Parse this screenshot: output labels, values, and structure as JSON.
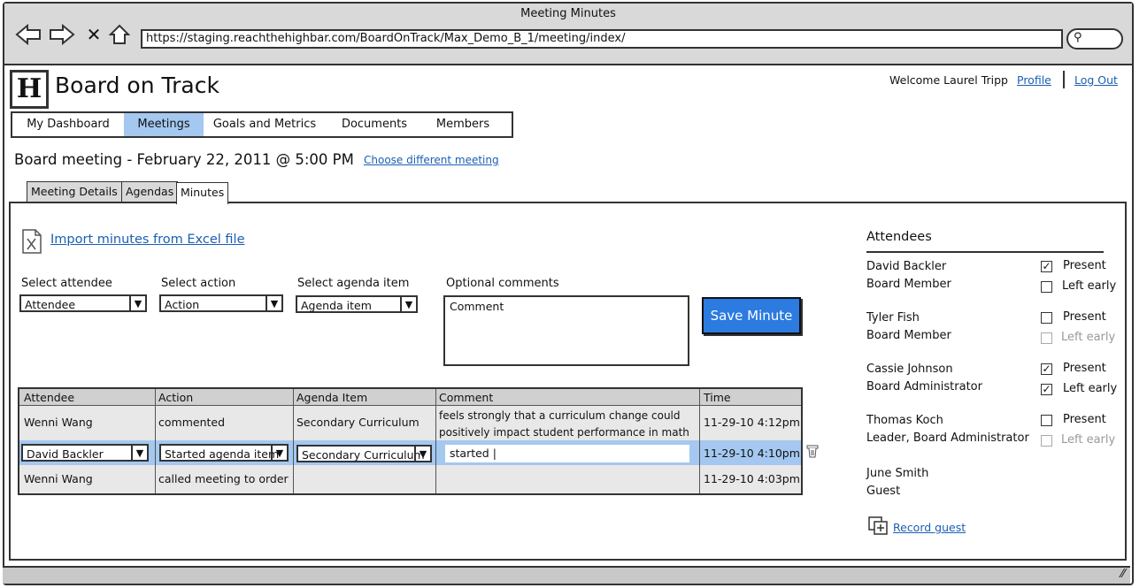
{
  "window": {
    "title": "Meeting Minutes",
    "url": "https://staging.reachthehighbar.com/BoardOnTrack/Max_Demo_B_1/meeting/index/"
  },
  "app": {
    "logo_letter": "H",
    "name": "Board on Track"
  },
  "user": {
    "welcome": "Welcome Laurel Tripp",
    "profile": "Profile",
    "logout": "Log Out"
  },
  "nav": {
    "items": [
      "My Dashboard",
      "Meetings",
      "Goals and Metrics",
      "Documents",
      "Members"
    ],
    "active": "Meetings",
    "accent": "#a4c8f0"
  },
  "meeting": {
    "title": "Board meeting - February 22, 2011 @ 5:00 PM",
    "change_link": "Choose different meeting"
  },
  "tabs": [
    "Meeting Details",
    "Agendas",
    "Minutes"
  ],
  "import": {
    "label": "Import minutes from Excel file",
    "icon": "excel-file-icon"
  },
  "form": {
    "attendee_label": "Select attendee",
    "attendee_value": "Attendee",
    "action_label": "Select action",
    "action_value": "Action",
    "agenda_label": "Select agenda item",
    "agenda_value": "Agenda item",
    "comments_label": "Optional comments",
    "comments_placeholder": "Comment",
    "save": "Save Minute",
    "save_color": "#2b7be0"
  },
  "table": {
    "headers": [
      "Attendee",
      "Action",
      "Agenda Item",
      "Comment",
      "Time"
    ],
    "rows": [
      {
        "attendee": "Wenni Wang",
        "action": "commented",
        "agenda": "Secondary Curriculum",
        "comment": "feels strongly that a curriculum change could positively impact student performance in math",
        "time": "11-29-10 4:12pm"
      },
      {
        "attendee": "David Backler",
        "action": "Started agenda item",
        "agenda": "Secondary Curriculum",
        "comment": "started |",
        "time": "11-29-10 4:10pm"
      },
      {
        "attendee": "Wenni Wang",
        "action": "called meeting to order",
        "agenda": "",
        "comment": "",
        "time": "11-29-10 4:03pm"
      }
    ]
  },
  "attendees": {
    "heading": "Attendees",
    "list": [
      {
        "name": "David Backler",
        "role": "Board Member",
        "present": true,
        "left_early": false,
        "left_early_enabled": true
      },
      {
        "name": "Tyler Fish",
        "role": "Board Member",
        "present": false,
        "left_early": false,
        "left_early_enabled": false
      },
      {
        "name": "Cassie Johnson",
        "role": "Board Administrator",
        "present": true,
        "left_early": true,
        "left_early_enabled": true
      },
      {
        "name": "Thomas Koch",
        "role": "Leader, Board Administrator",
        "present": false,
        "left_early": false,
        "left_early_enabled": false
      },
      {
        "name": "June Smith",
        "role": "Guest"
      }
    ],
    "present_label": "Present",
    "left_early_label": "Left early",
    "record_guest": "Record guest"
  }
}
